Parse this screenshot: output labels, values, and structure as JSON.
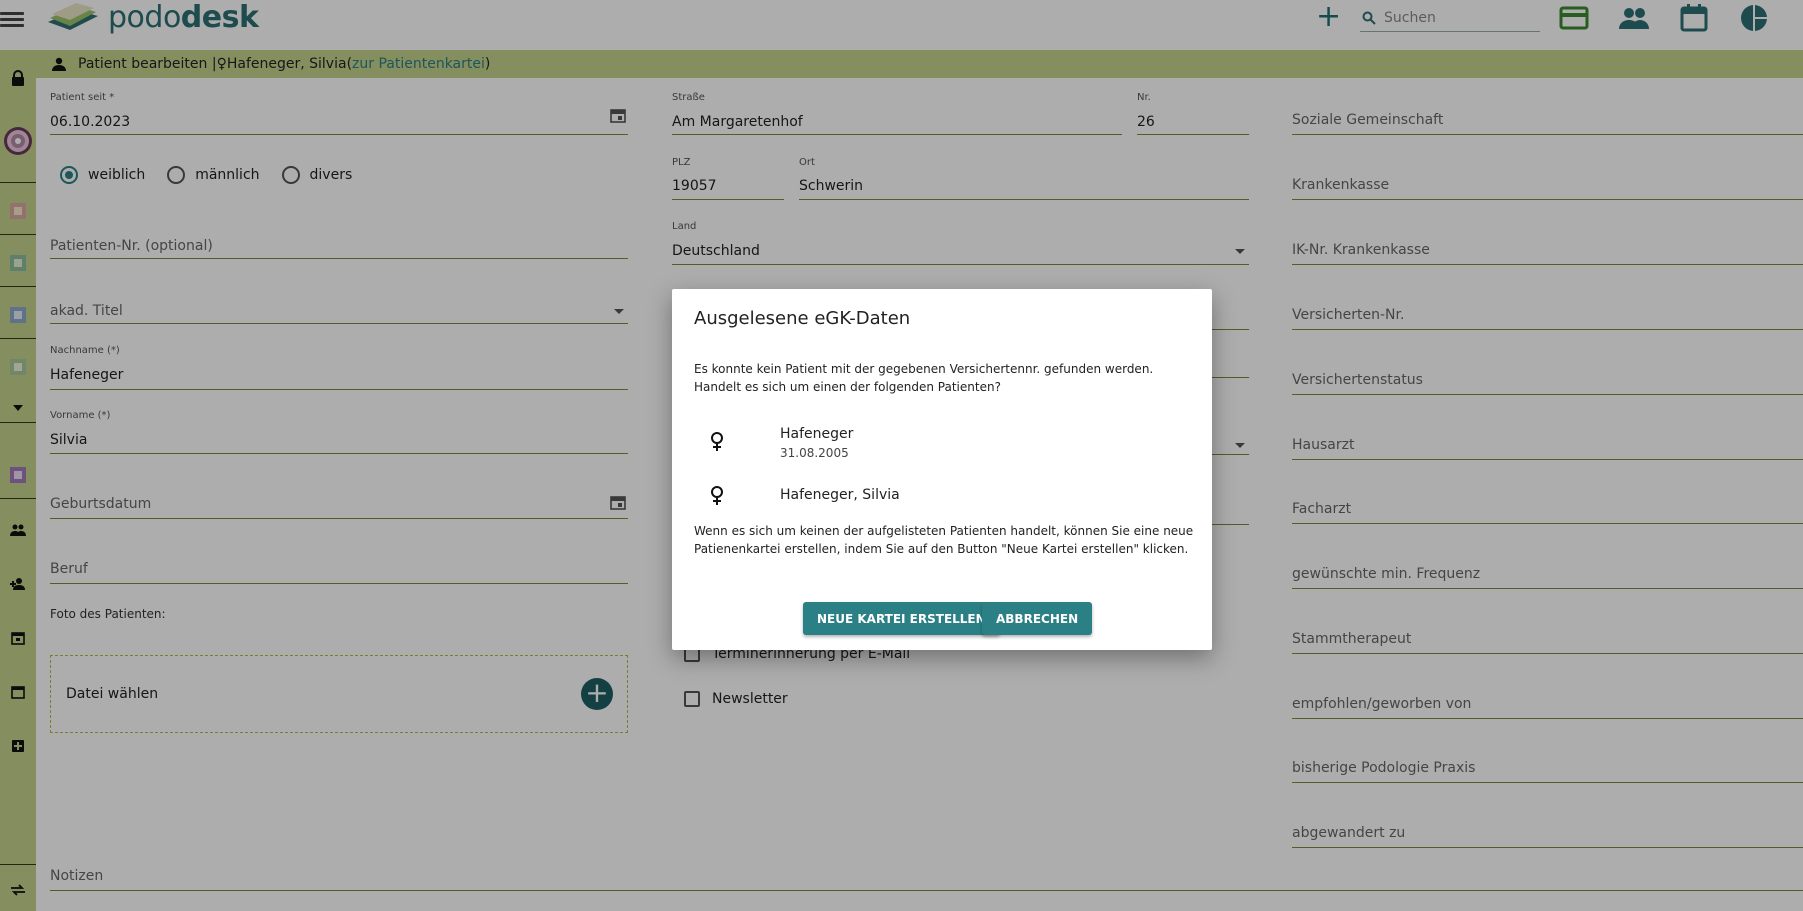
{
  "app": {
    "logo_text_light": "podo",
    "logo_text_bold": "desk"
  },
  "search": {
    "placeholder": "Suchen"
  },
  "header": {
    "prefix": "Patient bearbeiten |",
    "female_symbol": "♀",
    "patient": "Hafeneger, Silvia",
    "link_open": " (",
    "link": "zur Patientenkartei",
    "link_close": ")"
  },
  "form": {
    "patient_seit": {
      "label": "Patient seit *",
      "value": "06.10.2023"
    },
    "gender": {
      "options": [
        "weiblich",
        "männlich",
        "divers"
      ],
      "selected": "weiblich"
    },
    "patienten_nr": {
      "placeholder": "Patienten-Nr. (optional)"
    },
    "akad_titel": {
      "placeholder": "akad. Titel"
    },
    "nachname": {
      "label": "Nachname (*)",
      "value": "Hafeneger"
    },
    "vorname": {
      "label": "Vorname (*)",
      "value": "Silvia"
    },
    "geburtsdatum": {
      "placeholder": "Geburtsdatum"
    },
    "beruf": {
      "placeholder": "Beruf"
    },
    "foto_label": "Foto des Patienten:",
    "datei_waehlen": "Datei wählen",
    "strasse": {
      "label": "Straße",
      "value": "Am Margaretenhof"
    },
    "nr": {
      "label": "Nr.",
      "value": "26"
    },
    "plz": {
      "label": "PLZ",
      "value": "19057"
    },
    "ort": {
      "label": "Ort",
      "value": "Schwerin"
    },
    "land": {
      "label": "Land",
      "value": "Deutschland"
    },
    "terminerinnerung": "Terminerinnerung per E-Mail",
    "newsletter": "Newsletter",
    "notizen": {
      "placeholder": "Notizen"
    },
    "right_fields": [
      "Soziale Gemeinschaft",
      "Krankenkasse",
      "IK-Nr. Krankenkasse",
      "Versicherten-Nr.",
      "Versichertenstatus",
      "Hausarzt",
      "Facharzt",
      "gewünschte min. Frequenz",
      "Stammtherapeut",
      "empfohlen/geworben von",
      "bisherige Podologie Praxis",
      "abgewandert zu"
    ]
  },
  "dialog": {
    "title": "Ausgelesene eGK-Daten",
    "text": "Es konnte kein Patient mit der gegebenen Versichertennr. gefunden werden. Handelt es sich um einen der folgenden Patienten?",
    "patients": [
      {
        "name": "Hafeneger",
        "date": "31.08.2005"
      },
      {
        "name": "Hafeneger, Silvia",
        "date": ""
      }
    ],
    "footer": "Wenn es sich um keinen der aufgelisteten Patienten handelt, können Sie eine neue Patienenkartei erstellen, indem Sie auf den Button \"Neue Kartei erstellen\" klicken.",
    "btn_new": "NEUE KARTEI ERSTELLEN",
    "btn_cancel": "ABBRECHEN"
  },
  "colors": {
    "accent": "#2b8086",
    "sidebar": "#c4d28d",
    "logo": "#2b6f74"
  }
}
